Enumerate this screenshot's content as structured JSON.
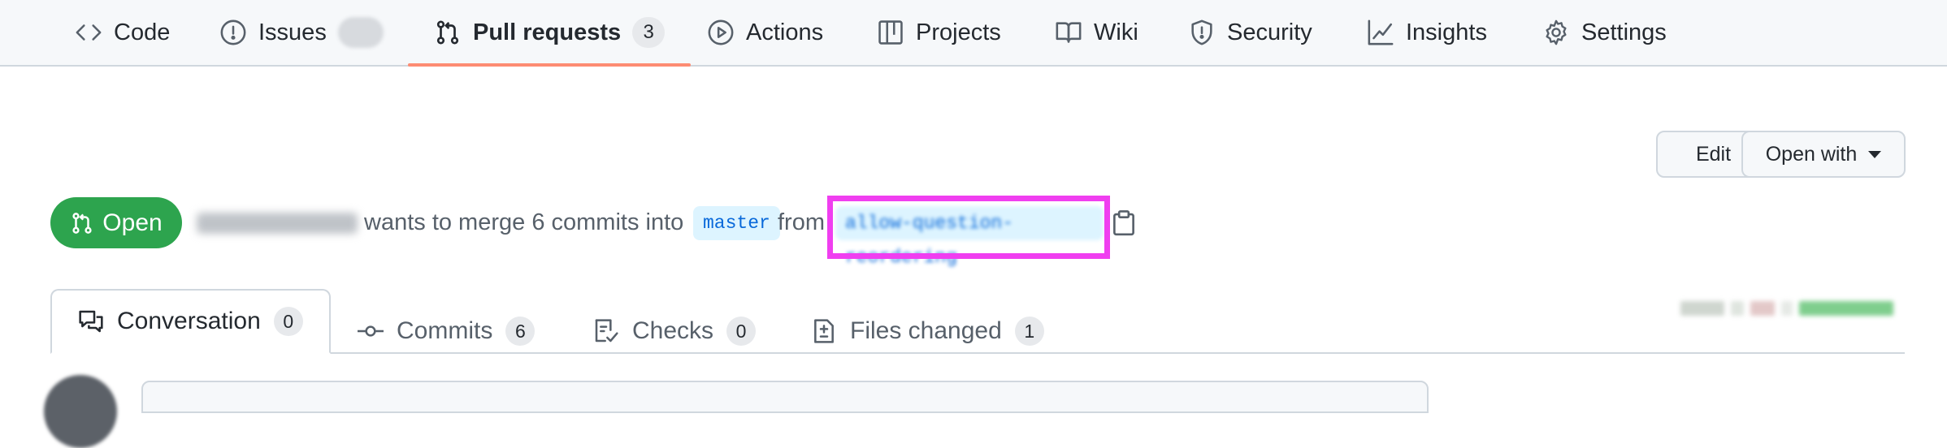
{
  "repo_nav": {
    "items": [
      {
        "label": "Code",
        "icon": "code-icon"
      },
      {
        "label": "Issues",
        "icon": "issue-opened-icon",
        "counter": ""
      },
      {
        "label": "Pull requests",
        "icon": "git-pull-request-icon",
        "counter": "3",
        "active": true
      },
      {
        "label": "Actions",
        "icon": "play-icon"
      },
      {
        "label": "Projects",
        "icon": "table-icon"
      },
      {
        "label": "Wiki",
        "icon": "book-icon"
      },
      {
        "label": "Security",
        "icon": "shield-icon"
      },
      {
        "label": "Insights",
        "icon": "graph-icon"
      },
      {
        "label": "Settings",
        "icon": "gear-icon"
      }
    ]
  },
  "pull_request": {
    "title": "",
    "actions": {
      "edit_label": "Edit",
      "open_with_label": "Open with"
    },
    "state": "Open",
    "author": "",
    "merge_text": "wants to merge 6 commits into",
    "base_branch": "master",
    "from_text": "from",
    "head_branch": "allow-question-reordering"
  },
  "tabs": [
    {
      "label": "Conversation",
      "icon": "comment-discussion-icon",
      "count": "0",
      "active": true
    },
    {
      "label": "Commits",
      "icon": "git-commit-icon",
      "count": "6"
    },
    {
      "label": "Checks",
      "icon": "checklist-icon",
      "count": "0"
    },
    {
      "label": "Files changed",
      "icon": "file-diff-icon",
      "count": "1"
    }
  ],
  "colors": {
    "open_badge": "#2da44e",
    "active_underline": "#fd8c73",
    "highlight_box": "#f03ef0",
    "branch_bg": "#ddf4ff",
    "branch_text": "#0969da"
  }
}
